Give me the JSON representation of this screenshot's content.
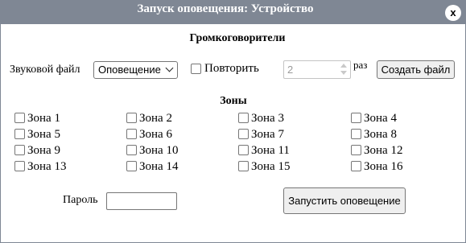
{
  "dialog": {
    "title": "Запуск оповещения: Устройство",
    "close_label": "x"
  },
  "speakers": {
    "section_title": "Громкоговорители",
    "sound_file_label": "Звуковой файл",
    "sound_file_selected": "Оповещение",
    "repeat_label": "Повторить",
    "repeat_count": "2",
    "times_label": "раз",
    "create_file_button": "Создать файл"
  },
  "zones": {
    "section_title": "Зоны",
    "items": [
      "Зона 1",
      "Зона 2",
      "Зона 3",
      "Зона 4",
      "Зона 5",
      "Зона 6",
      "Зона 7",
      "Зона 8",
      "Зона 9",
      "Зона 10",
      "Зона 11",
      "Зона 12",
      "Зона 13",
      "Зона 14",
      "Зона 15",
      "Зона 16"
    ]
  },
  "footer": {
    "password_label": "Пароль",
    "password_value": "",
    "start_button": "Запустить оповещение"
  }
}
